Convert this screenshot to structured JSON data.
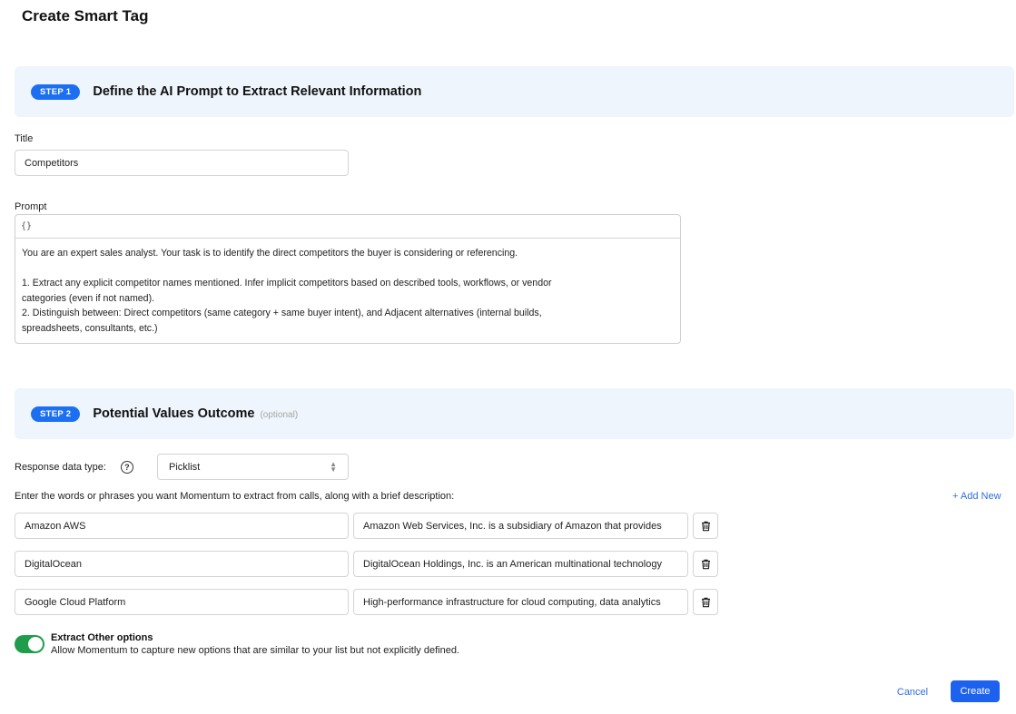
{
  "page": {
    "title": "Create Smart Tag"
  },
  "step1": {
    "badge": "STEP 1",
    "title": "Define the AI Prompt to Extract Relevant Information"
  },
  "title_field": {
    "label": "Title",
    "value": "Competitors"
  },
  "prompt_field": {
    "label": "Prompt",
    "toolbar_icon": "{}",
    "lines": [
      "You are an expert sales analyst. Your task is to identify the direct competitors the buyer is considering or referencing.",
      "",
      "1. Extract any explicit competitor names mentioned. Infer implicit competitors based on described tools, workflows, or vendor",
      "categories (even if not named).",
      "2. Distinguish between: Direct competitors (same category + same buyer intent), and Adjacent alternatives (internal builds,",
      "spreadsheets, consultants, etc.)"
    ]
  },
  "step2": {
    "badge": "STEP 2",
    "title": "Potential Values Outcome",
    "optional": "(optional)"
  },
  "response_type": {
    "label": "Response data type:",
    "help_icon": "question-circle-icon",
    "value": "Picklist"
  },
  "values": {
    "instruction": "Enter the words or phrases you want Momentum to extract from calls, along with a brief description:",
    "add_new": "+ Add New",
    "items": [
      {
        "name": "Amazon AWS",
        "description": "Amazon Web Services, Inc. is a subsidiary of Amazon that provides"
      },
      {
        "name": "DigitalOcean",
        "description": "DigitalOcean Holdings, Inc. is an American multinational technology"
      },
      {
        "name": "Google Cloud Platform",
        "description": "High-performance infrastructure for cloud computing, data analytics"
      }
    ]
  },
  "extract_other": {
    "enabled": true,
    "title": "Extract Other options",
    "description": "Allow Momentum to capture new options that are similar to your list but not explicitly defined."
  },
  "footer": {
    "cancel": "Cancel",
    "create": "Create"
  },
  "colors": {
    "accent": "#1d6ff2",
    "toggle_on": "#1f9d4c",
    "banner_bg": "#eef5fd",
    "link": "#2f6fe0"
  }
}
